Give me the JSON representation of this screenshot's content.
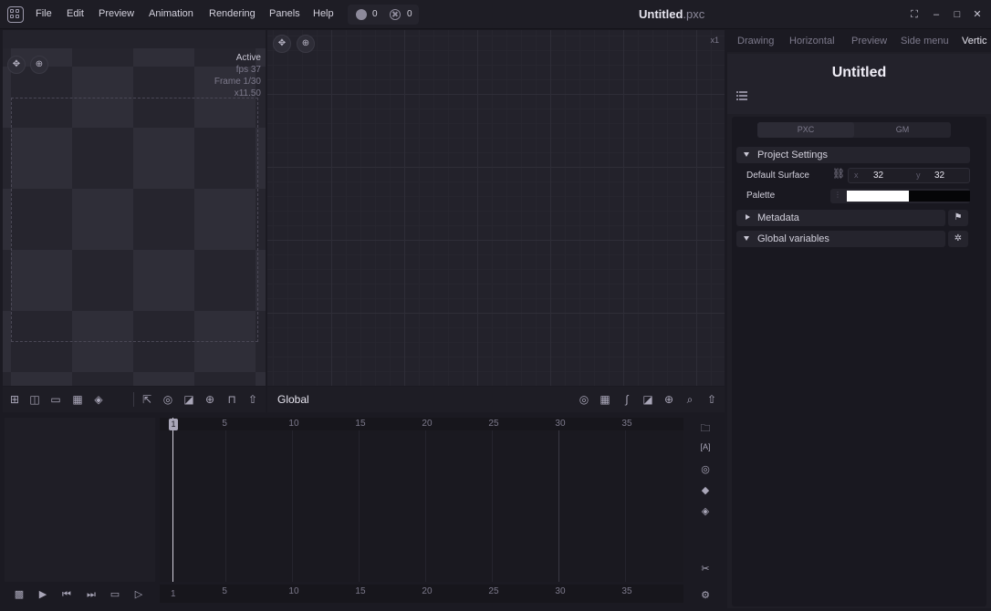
{
  "menu": [
    "File",
    "Edit",
    "Preview",
    "Animation",
    "Rendering",
    "Panels",
    "Help"
  ],
  "counters": {
    "warnings": "0",
    "errors": "0"
  },
  "window": {
    "title": "Untitled",
    "ext": ".pxc"
  },
  "preview": {
    "status": "Active",
    "fps": "fps 37",
    "frame": "Frame 1/30",
    "zoom": "x11.50"
  },
  "graph": {
    "zoom": "x1",
    "context": "Global"
  },
  "inspector": {
    "tabs": [
      "Drawing",
      "Horizontal",
      "Preview",
      "Side menu",
      "Vertic"
    ],
    "title": "Untitled",
    "segments": [
      "PXC",
      "GM"
    ],
    "sections": [
      "Project Settings",
      "Metadata",
      "Global variables"
    ],
    "default_surface": {
      "label": "Default Surface",
      "x_axis": "x",
      "x": "32",
      "y_axis": "y",
      "y": "32"
    },
    "palette_label": "Palette"
  },
  "timeline": {
    "ticks": [
      "5",
      "10",
      "15",
      "20",
      "25",
      "30",
      "35"
    ],
    "current_frame": "1"
  },
  "colors": {
    "accent": "#e6e4ee",
    "background": "#1b1a22",
    "panel": "#1f1e26"
  }
}
